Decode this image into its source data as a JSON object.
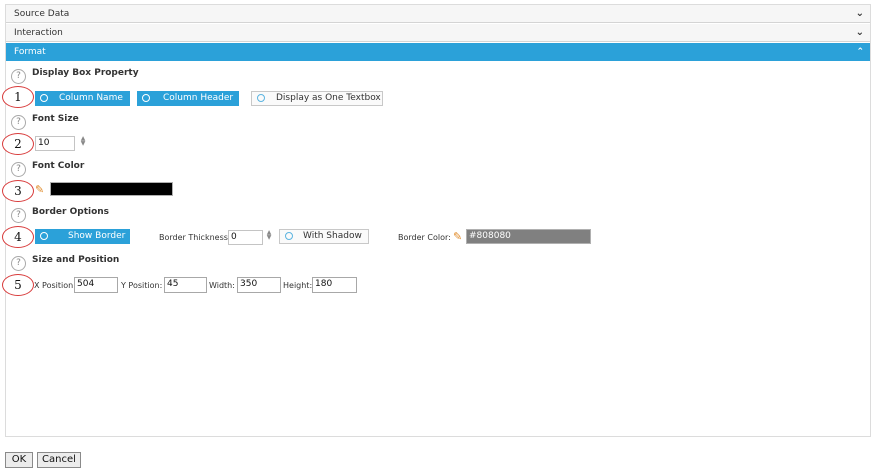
{
  "accordion": {
    "source_data": "Source Data",
    "interaction": "Interaction",
    "format": "Format"
  },
  "display_box": {
    "title": "Display Box Property",
    "marker": "1",
    "options": [
      "Column Name",
      "Column Header",
      "Display as One Textbox"
    ]
  },
  "font_size": {
    "title": "Font Size",
    "marker": "2",
    "value": "10"
  },
  "font_color": {
    "title": "Font Color",
    "marker": "3",
    "color": "#000000"
  },
  "border": {
    "title": "Border Options",
    "marker": "4",
    "show_border": "Show Border",
    "thickness_label": "Border Thickness:",
    "thickness_value": "0",
    "with_shadow": "With Shadow",
    "color_label": "Border Color:",
    "color_value": "#808080"
  },
  "size_position": {
    "title": "Size and Position",
    "marker": "5",
    "x_label": "X Position:",
    "x_value": "504",
    "y_label": "Y Position:",
    "y_value": "45",
    "width_label": "Width:",
    "width_value": "350",
    "height_label": "Height:",
    "height_value": "180"
  },
  "footer": {
    "ok": "OK",
    "cancel": "Cancel"
  },
  "colors": {
    "accent": "#2ba1d9",
    "marker_ring": "#d83a3a"
  },
  "icons": [
    "chevron-down-icon",
    "chevron-up-icon",
    "help-icon",
    "radio-icon",
    "pencil-icon",
    "spinner-icon"
  ]
}
